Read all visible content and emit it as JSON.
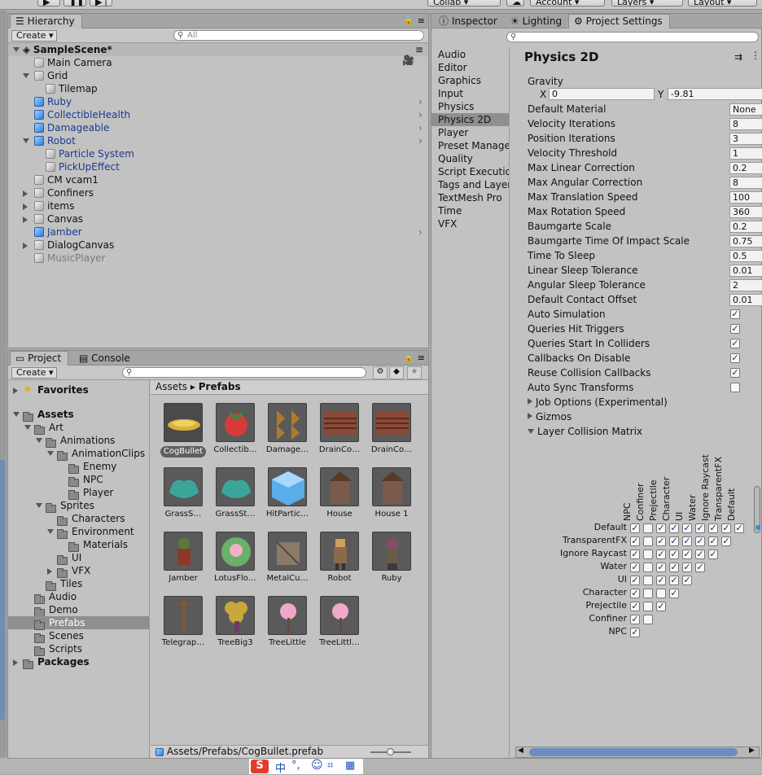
{
  "toolbar": {
    "collab": "Collab",
    "account": "Account",
    "layers": "Layers",
    "layout": "Layout"
  },
  "hierarchy": {
    "tab": "Hierarchy",
    "create": "Create",
    "search_placeholder": "All",
    "scene": "SampleScene*",
    "items": [
      {
        "label": "Main Camera",
        "depth": 1,
        "arrow": "",
        "icon": "gray",
        "style": ""
      },
      {
        "label": "Grid",
        "depth": 1,
        "arrow": "down",
        "icon": "gray",
        "style": ""
      },
      {
        "label": "Tilemap",
        "depth": 2,
        "arrow": "",
        "icon": "gray",
        "style": ""
      },
      {
        "label": "Ruby",
        "depth": 1,
        "arrow": "",
        "icon": "blue",
        "style": "blue",
        "chev": true
      },
      {
        "label": "CollectibleHealth",
        "depth": 1,
        "arrow": "",
        "icon": "blue",
        "style": "blue",
        "chev": true
      },
      {
        "label": "Damageable",
        "depth": 1,
        "arrow": "",
        "icon": "blue",
        "style": "blue",
        "chev": true
      },
      {
        "label": "Robot",
        "depth": 1,
        "arrow": "down",
        "icon": "blue",
        "style": "blue",
        "chev": true
      },
      {
        "label": "Particle System",
        "depth": 2,
        "arrow": "",
        "icon": "gray",
        "style": "blue"
      },
      {
        "label": "PickUpEffect",
        "depth": 2,
        "arrow": "",
        "icon": "gray",
        "style": "blue"
      },
      {
        "label": "CM vcam1",
        "depth": 1,
        "arrow": "",
        "icon": "gray",
        "style": ""
      },
      {
        "label": "Confiners",
        "depth": 1,
        "arrow": "right",
        "icon": "gray",
        "style": ""
      },
      {
        "label": "items",
        "depth": 1,
        "arrow": "right",
        "icon": "gray",
        "style": ""
      },
      {
        "label": "Canvas",
        "depth": 1,
        "arrow": "right",
        "icon": "gray",
        "style": ""
      },
      {
        "label": "Jamber",
        "depth": 1,
        "arrow": "",
        "icon": "blue",
        "style": "blue",
        "chev": true
      },
      {
        "label": "DialogCanvas",
        "depth": 1,
        "arrow": "right",
        "icon": "gray",
        "style": ""
      },
      {
        "label": "MusicPlayer",
        "depth": 1,
        "arrow": "",
        "icon": "gray",
        "style": "gray"
      }
    ]
  },
  "project": {
    "tab_project": "Project",
    "tab_console": "Console",
    "create": "Create",
    "badge_count": "",
    "tree": [
      {
        "label": "Favorites",
        "depth": 0,
        "arrow": "right",
        "icon": "star",
        "bold": true
      },
      {
        "label": "Assets",
        "depth": 0,
        "arrow": "down",
        "icon": "folder",
        "bold": true
      },
      {
        "label": "Art",
        "depth": 1,
        "arrow": "down",
        "icon": "folder"
      },
      {
        "label": "Animations",
        "depth": 2,
        "arrow": "down",
        "icon": "folder"
      },
      {
        "label": "AnimationClips",
        "depth": 3,
        "arrow": "down",
        "icon": "folder"
      },
      {
        "label": "Enemy",
        "depth": 4,
        "arrow": "",
        "icon": "folder"
      },
      {
        "label": "NPC",
        "depth": 4,
        "arrow": "",
        "icon": "folder"
      },
      {
        "label": "Player",
        "depth": 4,
        "arrow": "",
        "icon": "folder"
      },
      {
        "label": "Sprites",
        "depth": 2,
        "arrow": "down",
        "icon": "folder"
      },
      {
        "label": "Characters",
        "depth": 3,
        "arrow": "",
        "icon": "folder"
      },
      {
        "label": "Environment",
        "depth": 3,
        "arrow": "down",
        "icon": "folder"
      },
      {
        "label": "Materials",
        "depth": 4,
        "arrow": "",
        "icon": "folder"
      },
      {
        "label": "UI",
        "depth": 3,
        "arrow": "",
        "icon": "folder"
      },
      {
        "label": "VFX",
        "depth": 3,
        "arrow": "right",
        "icon": "folder"
      },
      {
        "label": "Tiles",
        "depth": 2,
        "arrow": "",
        "icon": "folder"
      },
      {
        "label": "Audio",
        "depth": 1,
        "arrow": "",
        "icon": "folder"
      },
      {
        "label": "Demo",
        "depth": 1,
        "arrow": "",
        "icon": "folder"
      },
      {
        "label": "Prefabs",
        "depth": 1,
        "arrow": "",
        "icon": "folder",
        "selected": true
      },
      {
        "label": "Scenes",
        "depth": 1,
        "arrow": "",
        "icon": "folder"
      },
      {
        "label": "Scripts",
        "depth": 1,
        "arrow": "",
        "icon": "folder"
      },
      {
        "label": "Packages",
        "depth": 0,
        "arrow": "right",
        "icon": "folder",
        "bold": true
      }
    ],
    "breadcrumb": {
      "root": "Assets",
      "current": "Prefabs"
    },
    "assets": [
      {
        "label": "CogBullet",
        "color": "#d6b23a",
        "shape": "cog",
        "selected": true
      },
      {
        "label": "Collectib…",
        "color": "#d83a3a",
        "shape": "berry"
      },
      {
        "label": "Damage…",
        "color": "#b07a2a",
        "shape": "spikes"
      },
      {
        "label": "DrainCo…",
        "color": "#8a4a36",
        "shape": "crate"
      },
      {
        "label": "DrainCo…",
        "color": "#8a4a36",
        "shape": "crate"
      },
      {
        "label": "GrassS…",
        "color": "#3aa59a",
        "shape": "bush"
      },
      {
        "label": "GrassSt…",
        "color": "#3aa59a",
        "shape": "bush"
      },
      {
        "label": "HitPartic…",
        "color": "#5aaee8",
        "shape": "cube"
      },
      {
        "label": "House",
        "color": "#7a5a4a",
        "shape": "house"
      },
      {
        "label": "House 1",
        "color": "#7a5a4a",
        "shape": "house"
      },
      {
        "label": "Jamber",
        "color": "#5a7a3a",
        "shape": "char"
      },
      {
        "label": "LotusFlo…",
        "color": "#6ab06a",
        "shape": "lotus"
      },
      {
        "label": "MetalCu…",
        "color": "#8a7a6a",
        "shape": "box"
      },
      {
        "label": "Robot",
        "color": "#8a6a4a",
        "shape": "robot"
      },
      {
        "label": "Ruby",
        "color": "#6a5a4a",
        "shape": "ruby"
      },
      {
        "label": "Telegrap…",
        "color": "#7a5a3a",
        "shape": "pole"
      },
      {
        "label": "TreeBig3",
        "color": "#c8a83a",
        "shape": "tree"
      },
      {
        "label": "TreeLittle",
        "color": "#f0a8c8",
        "shape": "pink"
      },
      {
        "label": "TreeLittl…",
        "color": "#f0a8c8",
        "shape": "pink"
      }
    ],
    "status_path": "Assets/Prefabs/CogBullet.prefab"
  },
  "right": {
    "tabs": [
      "Inspector",
      "Lighting",
      "Project Settings"
    ],
    "nav": [
      "Audio",
      "Editor",
      "Graphics",
      "Input",
      "Physics",
      "Physics 2D",
      "Player",
      "Preset Manage",
      "Quality",
      "Script Executio",
      "Tags and Layer",
      "TextMesh Pro",
      "Time",
      "VFX"
    ],
    "nav_selected": 5,
    "title": "Physics 2D",
    "gravity_label": "Gravity",
    "gx_label": "X",
    "gx": "0",
    "gy_label": "Y",
    "gy": "-9.81",
    "settings": [
      {
        "label": "Default Material",
        "value": "None"
      },
      {
        "label": "Velocity Iterations",
        "value": "8"
      },
      {
        "label": "Position Iterations",
        "value": "3"
      },
      {
        "label": "Velocity Threshold",
        "value": "1"
      },
      {
        "label": "Max Linear Correction",
        "value": "0.2"
      },
      {
        "label": "Max Angular Correction",
        "value": "8"
      },
      {
        "label": "Max Translation Speed",
        "value": "100"
      },
      {
        "label": "Max Rotation Speed",
        "value": "360"
      },
      {
        "label": "Baumgarte Scale",
        "value": "0.2"
      },
      {
        "label": "Baumgarte Time Of Impact Scale",
        "value": "0.75"
      },
      {
        "label": "Time To Sleep",
        "value": "0.5"
      },
      {
        "label": "Linear Sleep Tolerance",
        "value": "0.01"
      },
      {
        "label": "Angular Sleep Tolerance",
        "value": "2"
      },
      {
        "label": "Default Contact Offset",
        "value": "0.01"
      }
    ],
    "toggles": [
      {
        "label": "Auto Simulation",
        "checked": true
      },
      {
        "label": "Queries Hit Triggers",
        "checked": true
      },
      {
        "label": "Queries Start In Colliders",
        "checked": true
      },
      {
        "label": "Callbacks On Disable",
        "checked": true
      },
      {
        "label": "Reuse Collision Callbacks",
        "checked": true
      },
      {
        "label": "Auto Sync Transforms",
        "checked": false
      }
    ],
    "foldouts": [
      {
        "label": "Job Options (Experimental)",
        "open": false
      },
      {
        "label": "Gizmos",
        "open": false
      },
      {
        "label": "Layer Collision Matrix",
        "open": true
      }
    ],
    "matrix": {
      "columns": [
        "NPC",
        "Confiner",
        "Prejectile",
        "Character",
        "UI",
        "Water",
        "Ignore Raycast",
        "TransparentFX",
        "Default"
      ],
      "rows": [
        "Default",
        "TransparentFX",
        "Ignore Raycast",
        "Water",
        "UI",
        "Character",
        "Prejectile",
        "Confiner",
        "NPC"
      ],
      "checks": [
        [
          1,
          0,
          1,
          1,
          1,
          1,
          1,
          1,
          1
        ],
        [
          1,
          0,
          1,
          1,
          1,
          1,
          1,
          1
        ],
        [
          1,
          0,
          1,
          1,
          1,
          1,
          1
        ],
        [
          1,
          0,
          1,
          1,
          1,
          1
        ],
        [
          1,
          0,
          1,
          1,
          1
        ],
        [
          1,
          0,
          0,
          1
        ],
        [
          1,
          0,
          1
        ],
        [
          1,
          0
        ],
        [
          1
        ]
      ]
    }
  },
  "taskbar": {
    "glyph1": "中",
    "glyph2": "°,",
    "glyph3": "☺"
  }
}
